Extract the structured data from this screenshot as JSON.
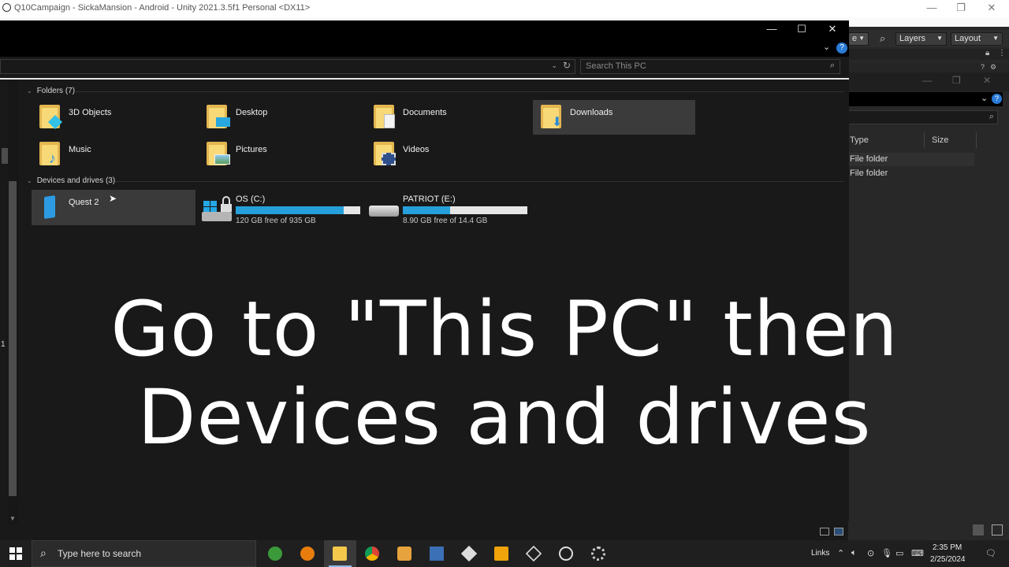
{
  "unity": {
    "title": "Q10Campaign - SickaMansion - Android - Unity 2021.3.5f1 Personal <DX11>",
    "partial_dropdown": "e",
    "layers_label": "Layers",
    "layout_label": "Layout",
    "columns": [
      "Type",
      "Size"
    ],
    "rows": [
      "File folder",
      "File folder"
    ]
  },
  "explorer": {
    "search_placeholder": "Search This PC",
    "folders_header": "Folders (7)",
    "folders": [
      {
        "label": "3D Objects",
        "icon": "3d-objects-icon"
      },
      {
        "label": "Desktop",
        "icon": "desktop-folder-icon"
      },
      {
        "label": "Documents",
        "icon": "documents-folder-icon"
      },
      {
        "label": "Downloads",
        "icon": "downloads-folder-icon"
      },
      {
        "label": "Music",
        "icon": "music-folder-icon"
      },
      {
        "label": "Pictures",
        "icon": "pictures-folder-icon"
      },
      {
        "label": "Videos",
        "icon": "videos-folder-icon"
      }
    ],
    "devices_header": "Devices and drives (3)",
    "devices": [
      {
        "label": "Quest 2",
        "icon": "portable-device-icon"
      },
      {
        "label": "OS (C:)",
        "free_text": "120 GB free of 935 GB",
        "used_fraction": 0.87,
        "icon": "windows-drive-icon"
      },
      {
        "label": "PATRIOT (E:)",
        "free_text": "8.90 GB free of 14.4 GB",
        "used_fraction": 0.38,
        "icon": "usb-drive-icon"
      }
    ],
    "nav_number": "1"
  },
  "caption": {
    "line1": "Go to \"This PC\" then",
    "line2": "Devices and drives"
  },
  "taskbar": {
    "search_placeholder": "Type here to search",
    "links_label": "Links",
    "time": "2:35 PM",
    "date": "2/25/2024"
  },
  "colors": {
    "accent_blue": "#26a0da",
    "folder_yellow": "#f8d978",
    "help_blue": "#2a7bd6"
  }
}
